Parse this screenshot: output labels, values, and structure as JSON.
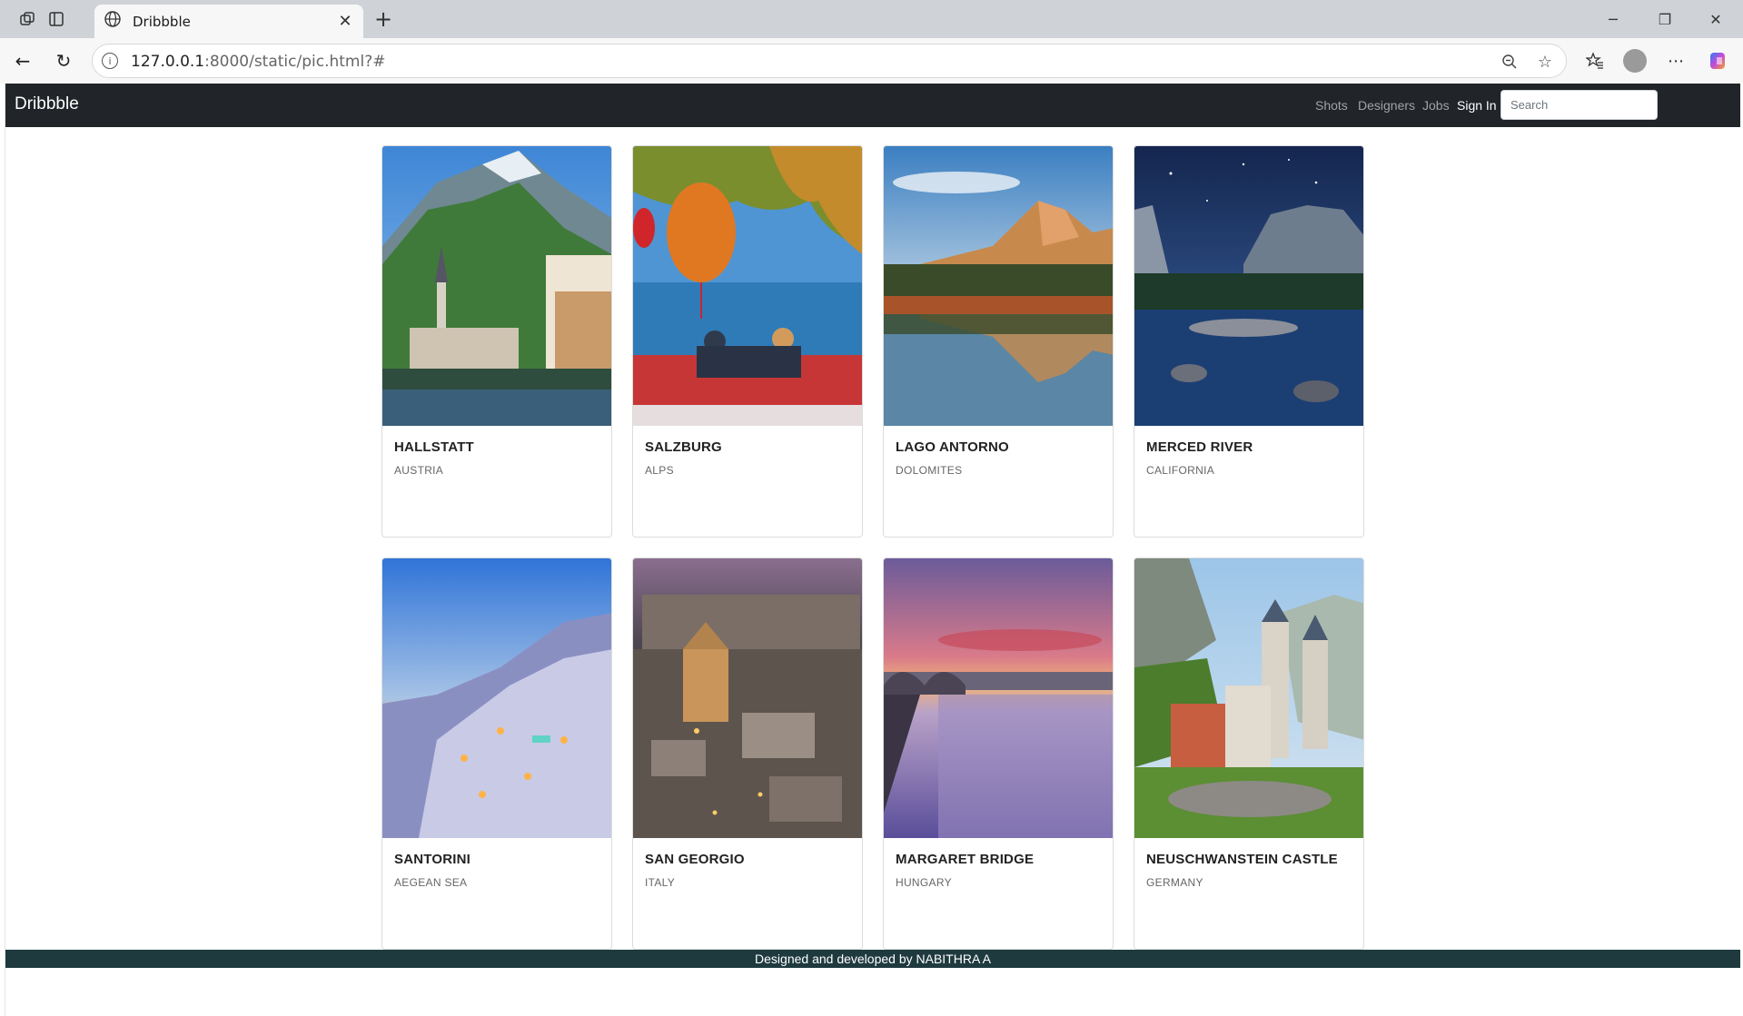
{
  "browser": {
    "tab_title": "Dribbble",
    "url_host": "127.0.0.1",
    "url_rest": ":8000/static/pic.html?#"
  },
  "navbar": {
    "brand": "Dribbble",
    "links": [
      "Shots",
      "Designers",
      "Jobs"
    ],
    "signin": "Sign In",
    "search_placeholder": "Search"
  },
  "cards": [
    {
      "title": "HALLSTATT",
      "subtitle": "AUSTRIA"
    },
    {
      "title": "SALZBURG",
      "subtitle": "ALPS"
    },
    {
      "title": "LAGO ANTORNO",
      "subtitle": "DOLOMITES"
    },
    {
      "title": "MERCED RIVER",
      "subtitle": "CALIFORNIA"
    },
    {
      "title": "SANTORINI",
      "subtitle": "AEGEAN SEA"
    },
    {
      "title": "SAN GEORGIO",
      "subtitle": "ITALY"
    },
    {
      "title": "MARGARET BRIDGE",
      "subtitle": "HUNGARY"
    },
    {
      "title": "NEUSCHWANSTEIN CASTLE",
      "subtitle": "GERMANY"
    }
  ],
  "footer": "Designed and developed by NABITHRA A",
  "colors": {
    "navbar_bg": "#212529",
    "footer_bg": "#1f3a3f"
  }
}
